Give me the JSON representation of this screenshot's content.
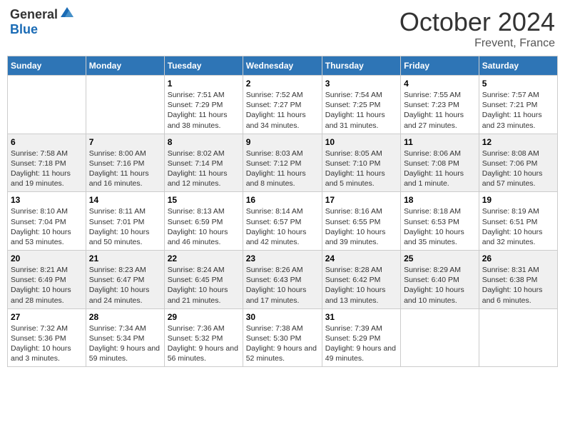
{
  "header": {
    "logo_general": "General",
    "logo_blue": "Blue",
    "month_title": "October 2024",
    "location": "Frevent, France"
  },
  "weekdays": [
    "Sunday",
    "Monday",
    "Tuesday",
    "Wednesday",
    "Thursday",
    "Friday",
    "Saturday"
  ],
  "weeks": [
    [
      {
        "day": "",
        "info": ""
      },
      {
        "day": "",
        "info": ""
      },
      {
        "day": "1",
        "info": "Sunrise: 7:51 AM\nSunset: 7:29 PM\nDaylight: 11 hours and 38 minutes."
      },
      {
        "day": "2",
        "info": "Sunrise: 7:52 AM\nSunset: 7:27 PM\nDaylight: 11 hours and 34 minutes."
      },
      {
        "day": "3",
        "info": "Sunrise: 7:54 AM\nSunset: 7:25 PM\nDaylight: 11 hours and 31 minutes."
      },
      {
        "day": "4",
        "info": "Sunrise: 7:55 AM\nSunset: 7:23 PM\nDaylight: 11 hours and 27 minutes."
      },
      {
        "day": "5",
        "info": "Sunrise: 7:57 AM\nSunset: 7:21 PM\nDaylight: 11 hours and 23 minutes."
      }
    ],
    [
      {
        "day": "6",
        "info": "Sunrise: 7:58 AM\nSunset: 7:18 PM\nDaylight: 11 hours and 19 minutes."
      },
      {
        "day": "7",
        "info": "Sunrise: 8:00 AM\nSunset: 7:16 PM\nDaylight: 11 hours and 16 minutes."
      },
      {
        "day": "8",
        "info": "Sunrise: 8:02 AM\nSunset: 7:14 PM\nDaylight: 11 hours and 12 minutes."
      },
      {
        "day": "9",
        "info": "Sunrise: 8:03 AM\nSunset: 7:12 PM\nDaylight: 11 hours and 8 minutes."
      },
      {
        "day": "10",
        "info": "Sunrise: 8:05 AM\nSunset: 7:10 PM\nDaylight: 11 hours and 5 minutes."
      },
      {
        "day": "11",
        "info": "Sunrise: 8:06 AM\nSunset: 7:08 PM\nDaylight: 11 hours and 1 minute."
      },
      {
        "day": "12",
        "info": "Sunrise: 8:08 AM\nSunset: 7:06 PM\nDaylight: 10 hours and 57 minutes."
      }
    ],
    [
      {
        "day": "13",
        "info": "Sunrise: 8:10 AM\nSunset: 7:04 PM\nDaylight: 10 hours and 53 minutes."
      },
      {
        "day": "14",
        "info": "Sunrise: 8:11 AM\nSunset: 7:01 PM\nDaylight: 10 hours and 50 minutes."
      },
      {
        "day": "15",
        "info": "Sunrise: 8:13 AM\nSunset: 6:59 PM\nDaylight: 10 hours and 46 minutes."
      },
      {
        "day": "16",
        "info": "Sunrise: 8:14 AM\nSunset: 6:57 PM\nDaylight: 10 hours and 42 minutes."
      },
      {
        "day": "17",
        "info": "Sunrise: 8:16 AM\nSunset: 6:55 PM\nDaylight: 10 hours and 39 minutes."
      },
      {
        "day": "18",
        "info": "Sunrise: 8:18 AM\nSunset: 6:53 PM\nDaylight: 10 hours and 35 minutes."
      },
      {
        "day": "19",
        "info": "Sunrise: 8:19 AM\nSunset: 6:51 PM\nDaylight: 10 hours and 32 minutes."
      }
    ],
    [
      {
        "day": "20",
        "info": "Sunrise: 8:21 AM\nSunset: 6:49 PM\nDaylight: 10 hours and 28 minutes."
      },
      {
        "day": "21",
        "info": "Sunrise: 8:23 AM\nSunset: 6:47 PM\nDaylight: 10 hours and 24 minutes."
      },
      {
        "day": "22",
        "info": "Sunrise: 8:24 AM\nSunset: 6:45 PM\nDaylight: 10 hours and 21 minutes."
      },
      {
        "day": "23",
        "info": "Sunrise: 8:26 AM\nSunset: 6:43 PM\nDaylight: 10 hours and 17 minutes."
      },
      {
        "day": "24",
        "info": "Sunrise: 8:28 AM\nSunset: 6:42 PM\nDaylight: 10 hours and 13 minutes."
      },
      {
        "day": "25",
        "info": "Sunrise: 8:29 AM\nSunset: 6:40 PM\nDaylight: 10 hours and 10 minutes."
      },
      {
        "day": "26",
        "info": "Sunrise: 8:31 AM\nSunset: 6:38 PM\nDaylight: 10 hours and 6 minutes."
      }
    ],
    [
      {
        "day": "27",
        "info": "Sunrise: 7:32 AM\nSunset: 5:36 PM\nDaylight: 10 hours and 3 minutes."
      },
      {
        "day": "28",
        "info": "Sunrise: 7:34 AM\nSunset: 5:34 PM\nDaylight: 9 hours and 59 minutes."
      },
      {
        "day": "29",
        "info": "Sunrise: 7:36 AM\nSunset: 5:32 PM\nDaylight: 9 hours and 56 minutes."
      },
      {
        "day": "30",
        "info": "Sunrise: 7:38 AM\nSunset: 5:30 PM\nDaylight: 9 hours and 52 minutes."
      },
      {
        "day": "31",
        "info": "Sunrise: 7:39 AM\nSunset: 5:29 PM\nDaylight: 9 hours and 49 minutes."
      },
      {
        "day": "",
        "info": ""
      },
      {
        "day": "",
        "info": ""
      }
    ]
  ]
}
